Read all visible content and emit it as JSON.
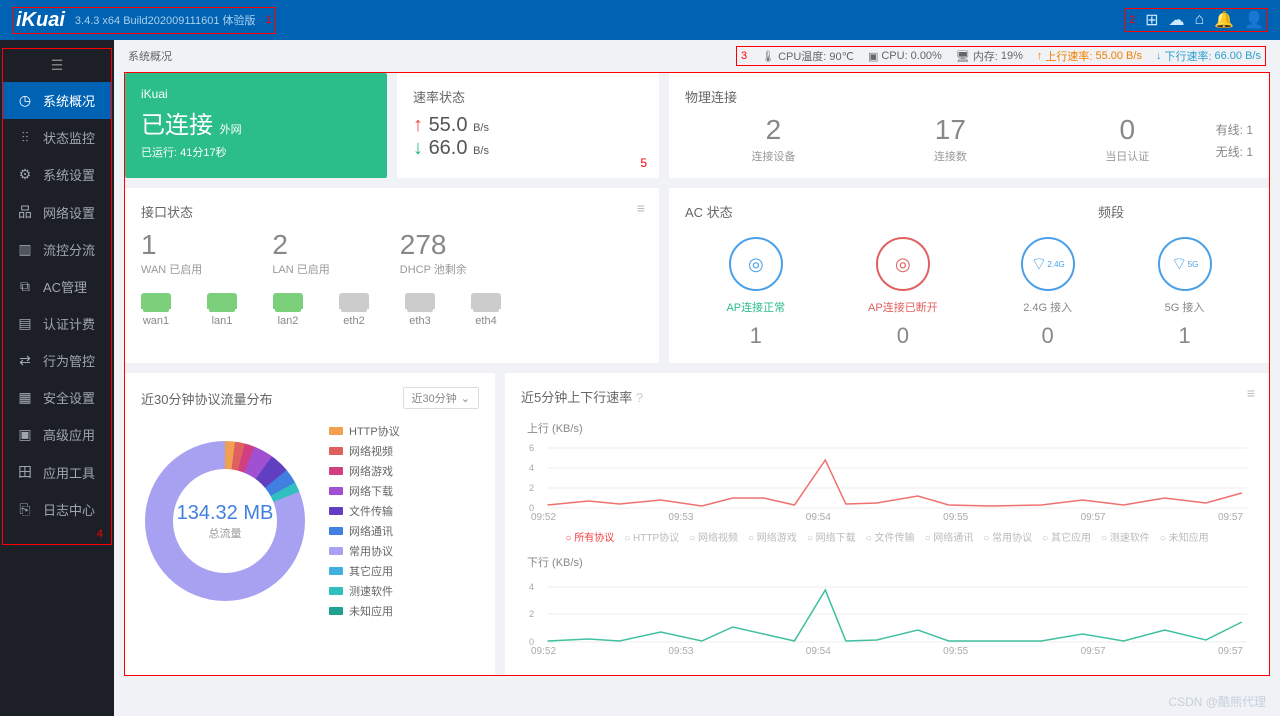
{
  "header": {
    "logo": "iKuai",
    "version": "3.4.3 x64 Build202009111601 体验版",
    "annot1": "1",
    "annot2": "2"
  },
  "sidebar": {
    "items": [
      {
        "icon": "◷",
        "label": "系统概况"
      },
      {
        "icon": "⫶⫶",
        "label": "状态监控"
      },
      {
        "icon": "⚙",
        "label": "系统设置"
      },
      {
        "icon": "品",
        "label": "网络设置"
      },
      {
        "icon": "▥",
        "label": "流控分流"
      },
      {
        "icon": "⧉",
        "label": "AC管理"
      },
      {
        "icon": "▤",
        "label": "认证计费"
      },
      {
        "icon": "⇄",
        "label": "行为管控"
      },
      {
        "icon": "▦",
        "label": "安全设置"
      },
      {
        "icon": "▣",
        "label": "高级应用"
      },
      {
        "icon": "田",
        "label": "应用工具"
      },
      {
        "icon": "⎘",
        "label": "日志中心"
      }
    ],
    "annot4": "4"
  },
  "statusbar": {
    "title": "系统概况",
    "annot3": "3",
    "cpu_temp_label": "CPU温度:",
    "cpu_temp": "90℃",
    "cpu_label": "CPU:",
    "cpu": "0.00%",
    "mem_label": "内存:",
    "mem": "19%",
    "up_label": "上行速率:",
    "up": "55.00 B/s",
    "down_label": "下行速率:",
    "down": "66.00 B/s"
  },
  "conn_card": {
    "brand": "iKuai",
    "status": "已连接",
    "suffix": "外网",
    "runtime": "已运行: 41分17秒"
  },
  "rate_card": {
    "title": "速率状态",
    "up": "55.0",
    "up_unit": "B/s",
    "down": "66.0",
    "down_unit": "B/s",
    "annot5": "5"
  },
  "phys_card": {
    "title": "物理连接",
    "items": [
      {
        "n": "2",
        "l": "连接设备"
      },
      {
        "n": "17",
        "l": "连接数"
      },
      {
        "n": "0",
        "l": "当日认证"
      }
    ],
    "wired": "有线: 1",
    "wireless": "无线: 1"
  },
  "iface_card": {
    "title": "接口状态",
    "stats": [
      {
        "n": "1",
        "l": "WAN 已启用"
      },
      {
        "n": "2",
        "l": "LAN 已启用"
      },
      {
        "n": "278",
        "l": "DHCP 池剩余"
      }
    ],
    "ports": [
      {
        "name": "wan1",
        "on": true
      },
      {
        "name": "lan1",
        "on": true
      },
      {
        "name": "lan2",
        "on": true
      },
      {
        "name": "eth2",
        "on": false
      },
      {
        "name": "eth3",
        "on": false
      },
      {
        "name": "eth4",
        "on": false
      }
    ]
  },
  "ac_card": {
    "title_left": "AC 状态",
    "title_right": "频段",
    "items": [
      {
        "lbl": "AP连接正常",
        "cls": "green",
        "n": "1",
        "ic": "◎"
      },
      {
        "lbl": "AP连接已断开",
        "cls": "red",
        "n": "0",
        "ic": "◎"
      },
      {
        "lbl": "2.4G 接入",
        "cls": "def",
        "n": "0",
        "ic": "⌔",
        "tag": "2.4G"
      },
      {
        "lbl": "5G 接入",
        "cls": "def",
        "n": "1",
        "ic": "⌔",
        "tag": "5G"
      }
    ]
  },
  "traffic_card": {
    "title": "近30分钟协议流量分布",
    "selector": "近30分钟",
    "total": "134.32 MB",
    "total_label": "总流量",
    "legend": [
      {
        "c": "#f0a050",
        "t": "HTTP协议"
      },
      {
        "c": "#e06060",
        "t": "网络视频"
      },
      {
        "c": "#d04080",
        "t": "网络游戏"
      },
      {
        "c": "#a050d0",
        "t": "网络下载"
      },
      {
        "c": "#6040c0",
        "t": "文件传输"
      },
      {
        "c": "#4080e0",
        "t": "网络通讯"
      },
      {
        "c": "#a8a0f0",
        "t": "常用协议"
      },
      {
        "c": "#40b0e0",
        "t": "其它应用"
      },
      {
        "c": "#30c0c0",
        "t": "测速软件"
      },
      {
        "c": "#20a090",
        "t": "未知应用"
      }
    ]
  },
  "speed_card": {
    "title": "近5分钟上下行速率",
    "up_title": "上行 (KB/s)",
    "down_title": "下行 (KB/s)",
    "xticks": [
      "09:52",
      "09:53",
      "09:54",
      "09:55",
      "09:57",
      "09:57"
    ],
    "up_yticks": [
      "6",
      "4",
      "2",
      "0"
    ],
    "down_yticks": [
      "4",
      "2",
      "0"
    ],
    "legend": [
      "所有协议",
      "HTTP协议",
      "网络视频",
      "网络游戏",
      "网络下载",
      "文件传输",
      "网络通讯",
      "常用协议",
      "其它应用",
      "测速软件",
      "未知应用"
    ]
  },
  "chart_data": [
    {
      "type": "pie",
      "title": "近30分钟协议流量分布",
      "total_mb": 134.32,
      "series": [
        {
          "name": "HTTP协议",
          "value": 2
        },
        {
          "name": "网络视频",
          "value": 2
        },
        {
          "name": "网络游戏",
          "value": 2
        },
        {
          "name": "网络下载",
          "value": 4
        },
        {
          "name": "文件传输",
          "value": 4
        },
        {
          "name": "网络通讯",
          "value": 3
        },
        {
          "name": "常用协议",
          "value": 81
        },
        {
          "name": "其它应用",
          "value": 1
        },
        {
          "name": "测速软件",
          "value": 1
        },
        {
          "name": "未知应用",
          "value": 0
        }
      ]
    },
    {
      "type": "line",
      "title": "上行 (KB/s)",
      "ylim": [
        0,
        6
      ],
      "x": [
        "09:52",
        "09:53",
        "09:54",
        "09:55",
        "09:57",
        "09:57"
      ],
      "series": [
        {
          "name": "所有协议",
          "values": [
            0.3,
            0.7,
            0.4,
            0.8,
            1.0,
            0.3,
            3.8,
            0.4,
            1.2,
            0.4,
            0.3,
            0.6,
            0.9,
            0.5,
            0.4,
            1.1
          ]
        }
      ]
    },
    {
      "type": "line",
      "title": "下行 (KB/s)",
      "ylim": [
        0,
        4
      ],
      "x": [
        "09:52",
        "09:53",
        "09:54",
        "09:55",
        "09:57",
        "09:57"
      ],
      "series": [
        {
          "name": "所有协议",
          "values": [
            0.1,
            0.3,
            0.1,
            0.6,
            1.0,
            0.2,
            3.6,
            0.2,
            0.8,
            0.2,
            0.1,
            0.3,
            0.7,
            0.2,
            0.2,
            1.4
          ]
        }
      ]
    }
  ],
  "watermark": "CSDN @酷熊代理"
}
